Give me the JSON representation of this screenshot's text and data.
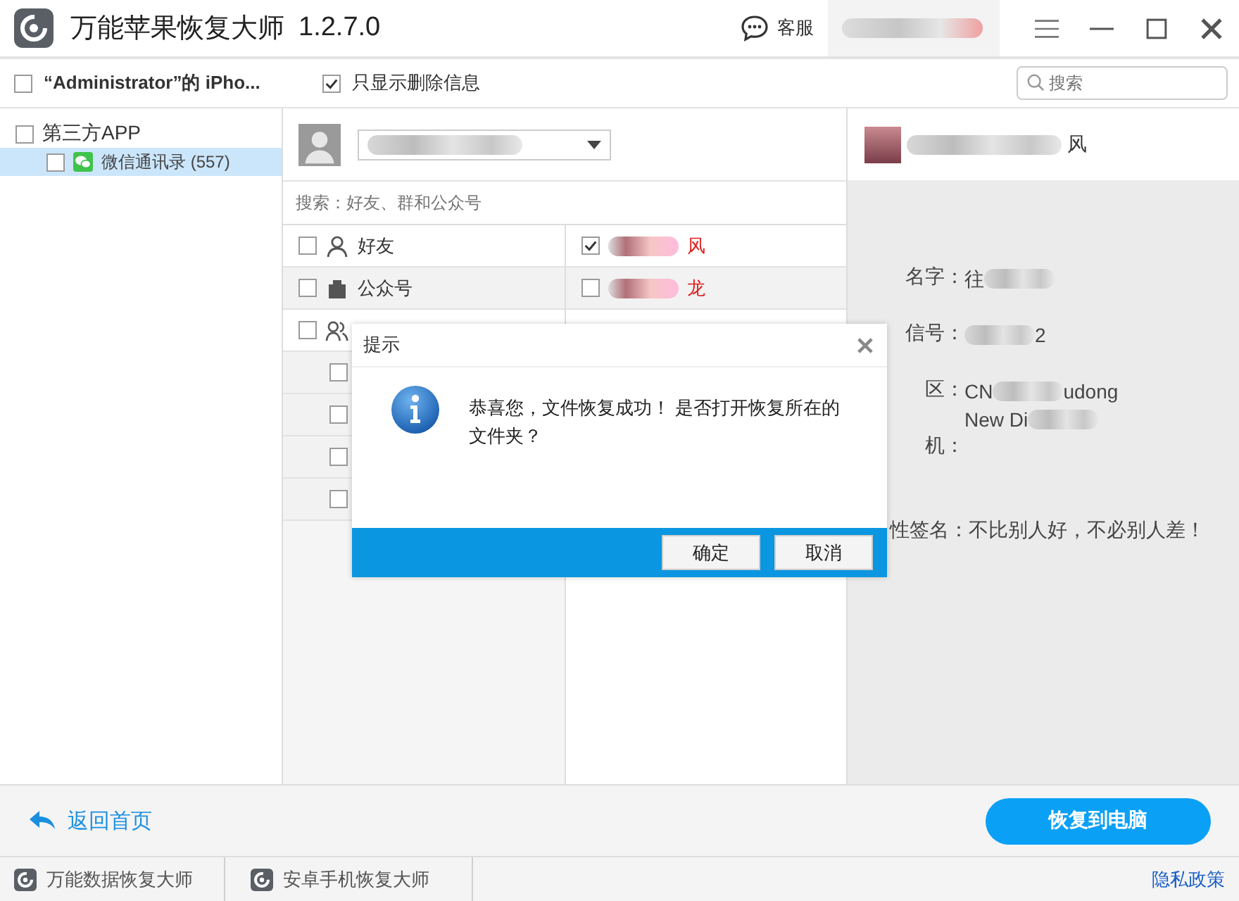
{
  "window": {
    "title": "万能苹果恢复大师",
    "version": "1.2.7.0",
    "support": "客服"
  },
  "toolbar": {
    "device": {
      "label": "“Administrator”的 iPho...",
      "checked": false
    },
    "deleted_only": {
      "label": "只显示删除信息",
      "checked": true
    },
    "search": {
      "placeholder": "搜索"
    }
  },
  "tree": [
    {
      "label": "第三方APP",
      "checked": false,
      "selected": false,
      "children": [
        {
          "label": "微信通讯录 (557)",
          "checked": false,
          "selected": true
        }
      ]
    }
  ],
  "contacts": {
    "search": {
      "placeholder": "搜索：好友、群和公众号"
    },
    "categories": [
      {
        "kind": "friend",
        "label": "好友",
        "checked": false
      },
      {
        "kind": "official",
        "label": "公众号",
        "checked": false
      },
      {
        "kind": "group",
        "checked": false
      }
    ],
    "members": [
      {
        "checked": false
      },
      {
        "checked": false
      },
      {
        "checked": false
      },
      {
        "checked": false
      }
    ]
  },
  "entries": [
    {
      "name": "风",
      "checked": true
    },
    {
      "name": "龙",
      "checked": false
    }
  ],
  "details": {
    "name": "风",
    "fields": [
      {
        "label": "名字：",
        "lines": [
          [
            {
              "text": "往"
            },
            {
              "kind": "blur"
            }
          ]
        ]
      },
      {
        "label": "信号：",
        "lines": [
          [
            {
              "kind": "blur"
            },
            {
              "text": "2"
            }
          ]
        ]
      },
      {
        "label": "区：",
        "lines": [
          [
            {
              "text": "CN"
            },
            {
              "kind": "blur"
            },
            {
              "text": "udong"
            }
          ],
          [
            {
              "text": "New Di"
            },
            {
              "kind": "blur"
            }
          ]
        ]
      },
      {
        "label": "机："
      }
    ],
    "signature": {
      "label": "性签名：",
      "value": "不比别人好，不必别人差！"
    }
  },
  "dialog": {
    "title": "提示",
    "message": "恭喜您，文件恢复成功！ 是否打开恢复所在的文件夹？",
    "buttons": [
      "确定",
      "取消"
    ]
  },
  "footer": {
    "back": "返回首页",
    "restore": "恢复到电脑"
  },
  "bottom_bar": {
    "tabs": [
      "万能数据恢复大师",
      "安卓手机恢复大师"
    ],
    "privacy": "隐私政策"
  }
}
